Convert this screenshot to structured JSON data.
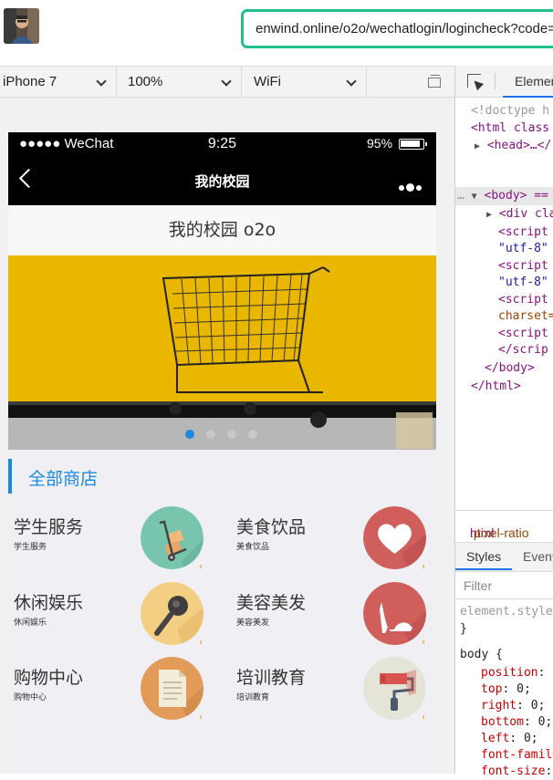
{
  "browser": {
    "url": "enwind.online/o2o/wechatlogin/logincheck?code=",
    "device": "iPhone 7",
    "zoom": "100%",
    "network": "WiFi"
  },
  "phone": {
    "carrier": "●●●●● WeChat",
    "time": "9:25",
    "battery": "95%",
    "battery_level": 0.95,
    "nav_title": "我的校园",
    "page_title": "我的校园 o2o",
    "banner_slide_count": 4,
    "banner_active_index": 0,
    "section_title": "全部商店",
    "categories": [
      {
        "name": "学生服务",
        "sub": "学生服务",
        "icon": "hand-truck-icon",
        "color": "#78c5ae"
      },
      {
        "name": "美食饮品",
        "sub": "美食饮品",
        "icon": "heart-icon",
        "color": "#d05f5c"
      },
      {
        "name": "休闲娱乐",
        "sub": "休闲娱乐",
        "icon": "microphone-icon",
        "color": "#f4ce83"
      },
      {
        "name": "美容美发",
        "sub": "美容美发",
        "icon": "high-heel-icon",
        "color": "#d05f5c"
      },
      {
        "name": "购物中心",
        "sub": "购物中心",
        "icon": "document-icon",
        "color": "#e39b59"
      },
      {
        "name": "培训教育",
        "sub": "培训教育",
        "icon": "paint-roller-icon",
        "color": "#e5e4d8"
      }
    ]
  },
  "devtools": {
    "tab_elements": "Elements",
    "dom": {
      "doctype": "<!doctype h",
      "html_open": "<html class",
      "head": "<head>…</",
      "body_open": "<body> ==",
      "div": "<div cla",
      "script1": "<script",
      "utf8_1": "\"utf-8\"",
      "script2": "<script",
      "utf8_2": "\"utf-8\"",
      "script3": "<script",
      "charset": "charset=",
      "script4": "<script",
      "script_close": "</scrip",
      "body_close": "</body>",
      "html_close": "</html>"
    },
    "breadcrumb": "html.pixel-ratio",
    "styles_tab": "Styles",
    "event_tab": "Event",
    "filter_placeholder": "Filter",
    "css": {
      "element_style": "element.style",
      "close_brace": "}",
      "selector": "body {",
      "props": [
        {
          "p": "position",
          "v": ": ab"
        },
        {
          "p": "top",
          "v": ": 0;"
        },
        {
          "p": "right",
          "v": ": 0;"
        },
        {
          "p": "bottom",
          "v": ": 0;"
        },
        {
          "p": "left",
          "v": ": 0;"
        },
        {
          "p": "font-famil",
          "v": ""
        },
        {
          "p": "font-size",
          "v": ":"
        }
      ]
    }
  }
}
